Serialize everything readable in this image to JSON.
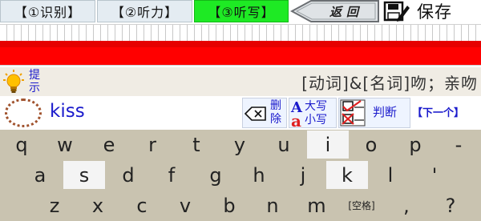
{
  "tabs": [
    {
      "label": "【①识别】",
      "active": false
    },
    {
      "label": "【②听力】",
      "active": false
    },
    {
      "label": "【③听写】",
      "active": true
    }
  ],
  "toolbar": {
    "back_label": "返回",
    "save_label": "保存"
  },
  "hint": {
    "label": "提示",
    "meaning": "[动词]&[名词]吻；亲吻"
  },
  "answer": {
    "word": "kiss"
  },
  "tools": {
    "delete_label": "删除",
    "case_upper": "大写",
    "case_lower": "小写",
    "check_label": "判断",
    "next_label": "【下一个】"
  },
  "keyboard": {
    "row1": [
      "q",
      "w",
      "e",
      "r",
      "t",
      "y",
      "u",
      "i",
      "o",
      "p",
      "-"
    ],
    "row2": [
      "a",
      "s",
      "d",
      "f",
      "g",
      "h",
      "j",
      "k",
      "l",
      "'"
    ],
    "row3": [
      "z",
      "x",
      "c",
      "v",
      "b",
      "n",
      "m",
      "[空格]",
      ",",
      "?"
    ],
    "highlighted": [
      "i",
      "s",
      "k"
    ]
  },
  "colors": {
    "active_tab": "#1eea24",
    "progress": "#ff0000",
    "accent_text": "#1a1acc",
    "keyboard_bg": "#c9c3b0"
  }
}
